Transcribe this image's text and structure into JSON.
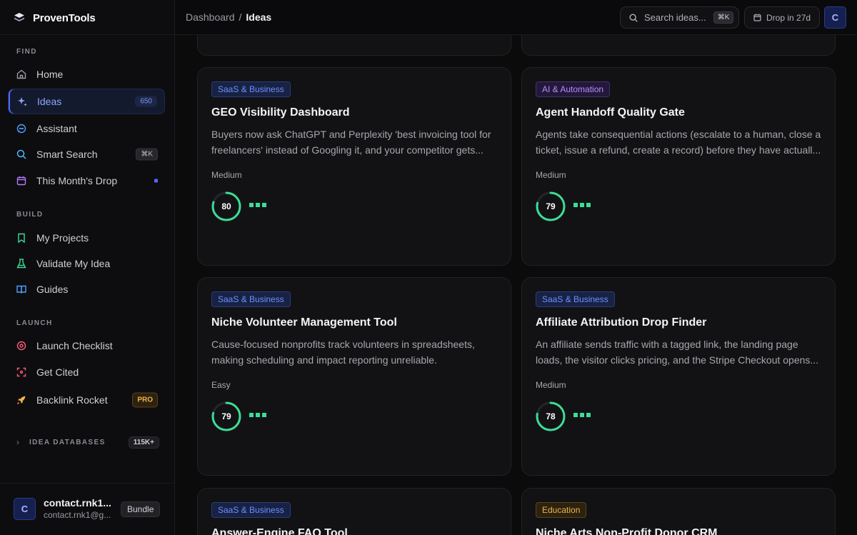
{
  "app": {
    "name": "ProvenTools"
  },
  "sidebar": {
    "sections": {
      "find": "FIND",
      "build": "BUILD",
      "launch": "LAUNCH"
    },
    "items": [
      {
        "label": "Home",
        "icon": "home-icon"
      },
      {
        "label": "Ideas",
        "icon": "sparkle-icon",
        "badge": "650",
        "active": true
      },
      {
        "label": "Assistant",
        "icon": "chat-icon"
      },
      {
        "label": "Smart Search",
        "icon": "search-icon",
        "kbd": "⌘K"
      },
      {
        "label": "This Month's Drop",
        "icon": "calendar-icon",
        "dot": true
      },
      {
        "label": "My Projects",
        "icon": "bookmark-icon"
      },
      {
        "label": "Validate My Idea",
        "icon": "flask-icon"
      },
      {
        "label": "Guides",
        "icon": "book-icon"
      },
      {
        "label": "Launch Checklist",
        "icon": "target-icon"
      },
      {
        "label": "Get Cited",
        "icon": "scan-icon"
      },
      {
        "label": "Backlink Rocket",
        "icon": "rocket-icon",
        "pro": "PRO"
      }
    ],
    "databases": {
      "label": "IDEA DATABASES",
      "count": "115K+"
    },
    "user": {
      "initial": "C",
      "name": "contact.rnk1...",
      "email": "contact.rnk1@g...",
      "plan": "Bundle"
    }
  },
  "topbar": {
    "breadcrumb": {
      "parent": "Dashboard",
      "separator": "/",
      "current": "Ideas"
    },
    "search": {
      "placeholder": "Search ideas...",
      "kbd": "⌘K"
    },
    "drop": {
      "label": "Drop in 27d"
    },
    "avatar": "C"
  },
  "colors": {
    "accent": "#4f6bff",
    "score": "#3ddc97",
    "pro": "#f1b24a"
  },
  "cards": [
    {
      "tag": "SaaS & Business",
      "tag_style": "blue",
      "title": "GEO Visibility Dashboard",
      "description": "Buyers now ask ChatGPT and Perplexity 'best invoicing tool for freelancers' instead of Googling it, and your competitor gets...",
      "difficulty": "Medium",
      "score": 80
    },
    {
      "tag": "AI & Automation",
      "tag_style": "purple",
      "title": "Agent Handoff Quality Gate",
      "description": "Agents take consequential actions (escalate to a human, close a ticket, issue a refund, create a record) before they have actuall...",
      "difficulty": "Medium",
      "score": 79
    },
    {
      "tag": "SaaS & Business",
      "tag_style": "blue",
      "title": "Niche Volunteer Management Tool",
      "description": "Cause-focused nonprofits track volunteers in spreadsheets, making scheduling and impact reporting unreliable.",
      "difficulty": "Easy",
      "score": 79
    },
    {
      "tag": "SaaS & Business",
      "tag_style": "blue",
      "title": "Affiliate Attribution Drop Finder",
      "description": "An affiliate sends traffic with a tagged link, the landing page loads, the visitor clicks pricing, and the Stripe Checkout opens...",
      "difficulty": "Medium",
      "score": 78
    },
    {
      "tag": "SaaS & Business",
      "tag_style": "blue",
      "title": "Answer-Engine FAQ Tool"
    },
    {
      "tag": "Education",
      "tag_style": "amber",
      "title": "Niche Arts Non-Profit Donor CRM"
    }
  ]
}
